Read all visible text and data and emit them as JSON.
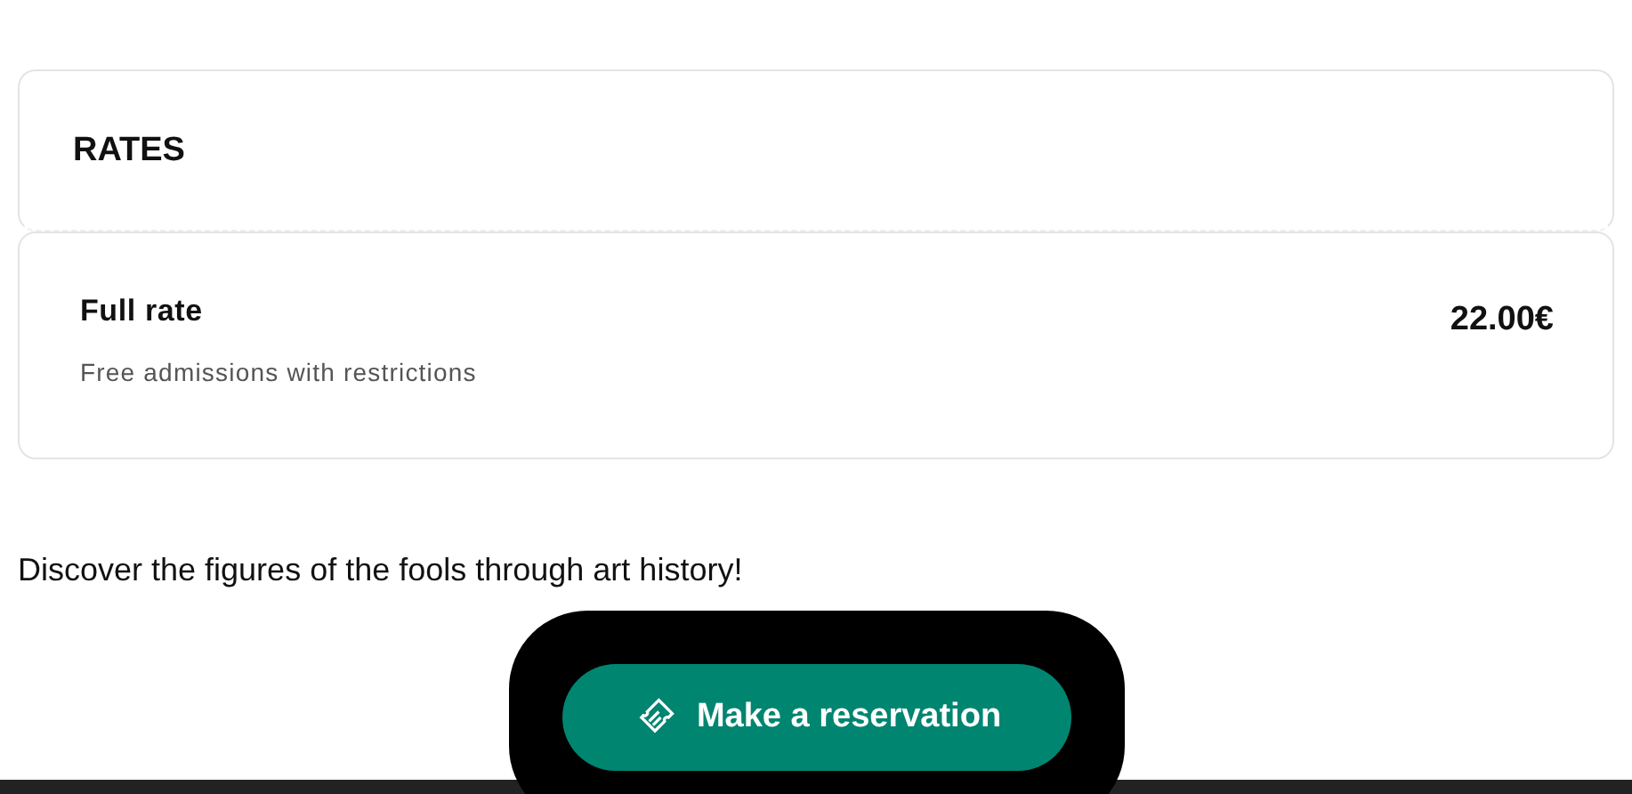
{
  "rates_card": {
    "title": "RATES"
  },
  "rates": [
    {
      "name": "Full rate",
      "note": "Free admissions with restrictions",
      "price": "22.00€"
    }
  ],
  "description": "Discover the figures of the fools through art history!",
  "reservation_button": {
    "label": "Make a reservation"
  }
}
